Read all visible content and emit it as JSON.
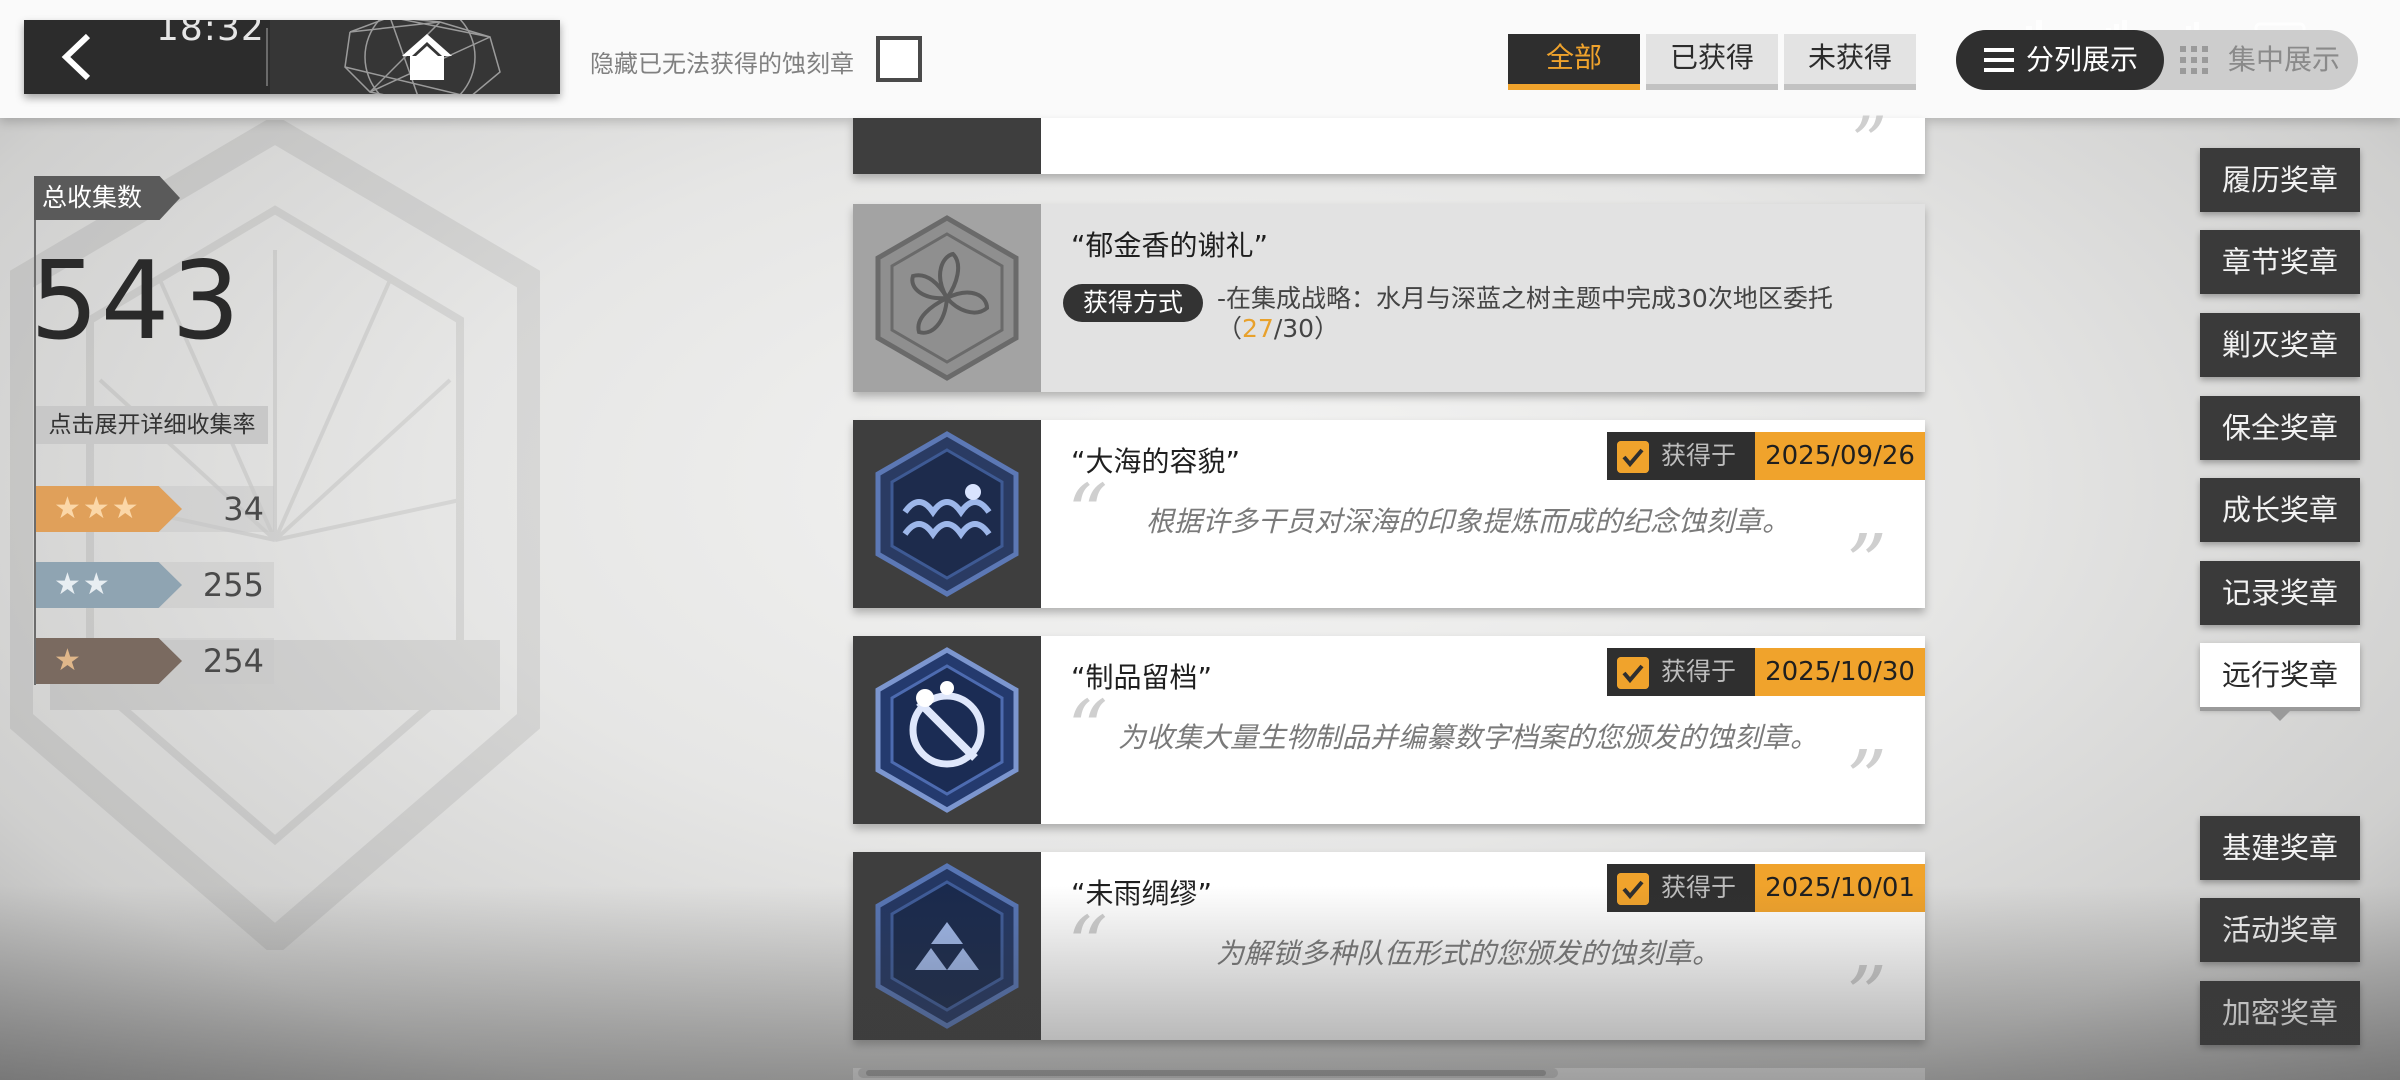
{
  "status": {
    "clock": "18:32"
  },
  "topbar": {
    "hide_label": "隐藏已无法获得的蚀刻章",
    "filters": [
      "全部",
      "已获得",
      "未获得"
    ],
    "view_split": "分列展示",
    "view_grouped": "集中展示"
  },
  "stats": {
    "total_label": "总收集数",
    "total": "543",
    "expand_label": "点击展开详细收集率",
    "rows": [
      {
        "stars": "★★★",
        "count": "34",
        "color": "#e0a05a"
      },
      {
        "stars": "★★",
        "count": "255",
        "color": "#8fa4b2"
      },
      {
        "stars": "★",
        "count": "254",
        "color": "#7a6a60"
      }
    ]
  },
  "cards": [
    {
      "title": "“郁金香的谢礼”",
      "state": "locked",
      "method_label": "获得方式",
      "method_text": "-在集成战略：水月与深蓝之树主题中完成30次地区委托",
      "progress_open": "（",
      "progress_current": "27",
      "progress_total": "/30）"
    },
    {
      "title": "“大海的容貌”",
      "state": "obtained",
      "obtained_label": "获得于",
      "date": "2025/09/26",
      "desc": "根据许多干员对深海的印象提炼而成的纪念蚀刻章。"
    },
    {
      "title": "“制品留档”",
      "state": "obtained",
      "obtained_label": "获得于",
      "date": "2025/10/30",
      "desc": "为收集大量生物制品并编纂数字档案的您颁发的蚀刻章。"
    },
    {
      "title": "“未雨绸缪”",
      "state": "obtained",
      "obtained_label": "获得于",
      "date": "2025/10/01",
      "desc": "为解锁多种队伍形式的您颁发的蚀刻章。"
    }
  ],
  "categories": [
    "履历奖章",
    "章节奖章",
    "剿灭奖章",
    "保全奖章",
    "成长奖章",
    "记录奖章",
    "远行奖章",
    "基建奖章",
    "活动奖章",
    "加密奖章"
  ],
  "active_category": "远行奖章",
  "colors": {
    "accent": "#f0a32c",
    "dark": "#2f2f2f"
  }
}
